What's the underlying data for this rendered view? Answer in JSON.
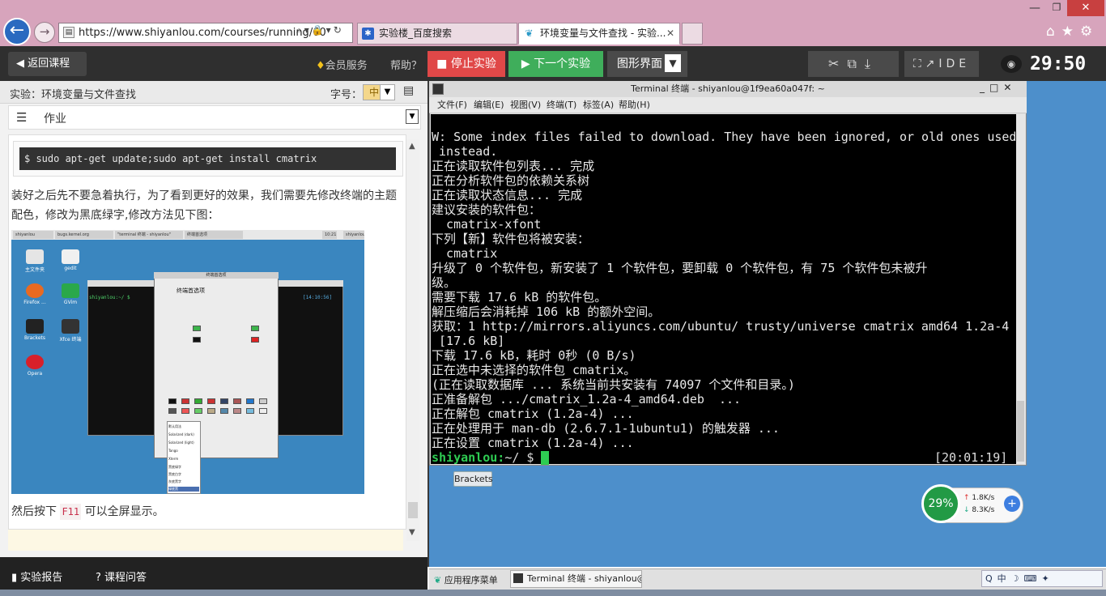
{
  "browser": {
    "url": "https://www.shiyanlou.com/courses/running/60",
    "tabs": [
      {
        "label": "实验楼_百度搜索"
      },
      {
        "label": "环境变量与文件查找 - 实验..."
      }
    ]
  },
  "toolbar": {
    "back_course": "返回课程",
    "member": "会员服务",
    "help": "帮助？",
    "stop": "停止实验",
    "next": "下一个实验",
    "gui": "图形界面",
    "ide": "IDE",
    "timer": "29:50"
  },
  "left": {
    "lab_title": "实验：环境变量与文件查找",
    "font_label": "字号：",
    "font_value": "中",
    "homework": "作业",
    "code": "$ sudo apt-get update;sudo apt-get install cmatrix",
    "para1": "装好之后先不要急着执行，为了看到更好的效果，我们需要先修改终端的主题配色，修改为黑底绿字,修改方法见下图：",
    "para2_prefix": "然后按下",
    "para2_key": "F11",
    "para2_suffix": "可以全屏显示。",
    "report": "实验报告",
    "qa": "课程问答"
  },
  "screenshot_img": {
    "tabs": [
      "shiyanlou",
      "bugs.kernel.org",
      "\"terminal 终端 - shiyanlou\"",
      "终端首选项",
      "10:21",
      "shiyanlou"
    ],
    "icons": [
      "主文件夹",
      "gedit",
      "Firefox ...",
      "GVim",
      "Brackets",
      "Xfce 终端",
      "Opera"
    ],
    "prompt": "shiyanlou:~/ $",
    "time": "[14:10:56]",
    "dialog_bar": "终端首选项",
    "dialog_title": "终端首选项",
    "menu_items": [
      "默认用法",
      "Solarized (dark)",
      "Solarized (light)",
      "Tango",
      "Xterm",
      "黑底绿字",
      "黑底白字",
      "灰底黑字",
      "绿底黑"
    ]
  },
  "terminal": {
    "title": "Terminal 终端 - shiyanlou@1f9ea60a047f: ~",
    "menu": [
      "文件(F)",
      "编辑(E)",
      "视图(V)",
      "终端(T)",
      "标签(A)",
      "帮助(H)"
    ],
    "lines": [
      "W: Some index files failed to download. They have been ignored, or old ones used",
      " instead.",
      "正在读取软件包列表... 完成",
      "正在分析软件包的依赖关系树",
      "正在读取状态信息... 完成",
      "建议安装的软件包：",
      "  cmatrix-xfont",
      "下列【新】软件包将被安装：",
      "  cmatrix",
      "升级了 0 个软件包，新安装了 1 个软件包，要卸载 0 个软件包，有 75 个软件包未被升",
      "级。",
      "需要下载 17.6 kB 的软件包。",
      "解压缩后会消耗掉 106 kB 的额外空间。",
      "获取：1 http://mirrors.aliyuncs.com/ubuntu/ trusty/universe cmatrix amd64 1.2a-4",
      " [17.6 kB]",
      "下载 17.6 kB，耗时 0秒 (0 B/s)",
      "正在选中未选择的软件包 cmatrix。",
      "(正在读取数据库 ... 系统当前共安装有 74097 个文件和目录。)",
      "正准备解包 .../cmatrix_1.2a-4_amd64.deb  ...",
      "正在解包 cmatrix (1.2a-4) ...",
      "正在处理用于 man-db (2.6.7.1-1ubuntu1) 的触发器 ...",
      "正在设置 cmatrix (1.2a-4) ..."
    ],
    "prompt_user": "shiyanlou:",
    "prompt_path": "~/ $",
    "clock": "[20:01:19]"
  },
  "vm": {
    "brackets_tip": "Brackets",
    "net_percent": "29%",
    "net_up": "1.8K/s",
    "net_down": "8.3K/s",
    "apps_menu": "应用程序菜单",
    "task_term": "Terminal 终端 - shiyanlou@...",
    "tray_ime": "中"
  },
  "colors": {
    "stop": "#e04848",
    "next": "#3fae5b",
    "prompt": "#2ecc52"
  }
}
